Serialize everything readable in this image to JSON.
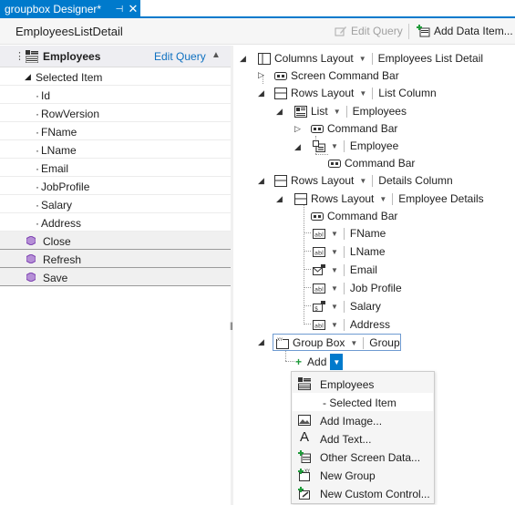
{
  "tab": {
    "title": "groupbox Designer*",
    "pin": "⊣",
    "close": "✕"
  },
  "header": {
    "screen_name": "EmployeesListDetail",
    "edit_query_label": "Edit Query",
    "add_data_item_label": "Add Data Item..."
  },
  "left_panel": {
    "entity": "Employees",
    "edit_query": "Edit Query",
    "selected_item": "Selected Item",
    "fields": [
      "Id",
      "RowVersion",
      "FName",
      "LName",
      "Email",
      "JobProfile",
      "Salary",
      "Address"
    ],
    "commands": [
      "Close",
      "Refresh",
      "Save"
    ]
  },
  "tree": {
    "root": {
      "layout": "Columns Layout",
      "name": "Employees List Detail"
    },
    "screen_command_bar": "Screen Command Bar",
    "list_column": {
      "layout": "Rows Layout",
      "name": "List Column"
    },
    "list": {
      "layout": "List",
      "name": "Employees"
    },
    "list_command_bar": "Command Bar",
    "employee": "Employee",
    "employee_command_bar": "Command Bar",
    "details_column": {
      "layout": "Rows Layout",
      "name": "Details Column"
    },
    "employee_details": {
      "layout": "Rows Layout",
      "name": "Employee Details"
    },
    "details_command_bar": "Command Bar",
    "fields": [
      "FName",
      "LName",
      "Email",
      "Job Profile",
      "Salary",
      "Address"
    ],
    "group": {
      "layout": "Group Box",
      "name": "Group"
    },
    "add_label": "Add"
  },
  "menu": {
    "items": [
      {
        "label": "Employees",
        "icon": "entity-icon"
      },
      {
        "label": "- Selected Item",
        "icon": ""
      },
      {
        "label": "Add Image...",
        "icon": "image-icon"
      },
      {
        "label": "Add Text...",
        "icon": "text-icon"
      },
      {
        "label": "Other Screen Data...",
        "icon": "screen-data-icon"
      },
      {
        "label": "New Group",
        "icon": "new-group-icon"
      },
      {
        "label": "New Custom Control...",
        "icon": "custom-control-icon"
      }
    ]
  },
  "colors": {
    "accent": "#007acc",
    "link": "#0e70c0",
    "command_cube": "#7b3fb0"
  }
}
